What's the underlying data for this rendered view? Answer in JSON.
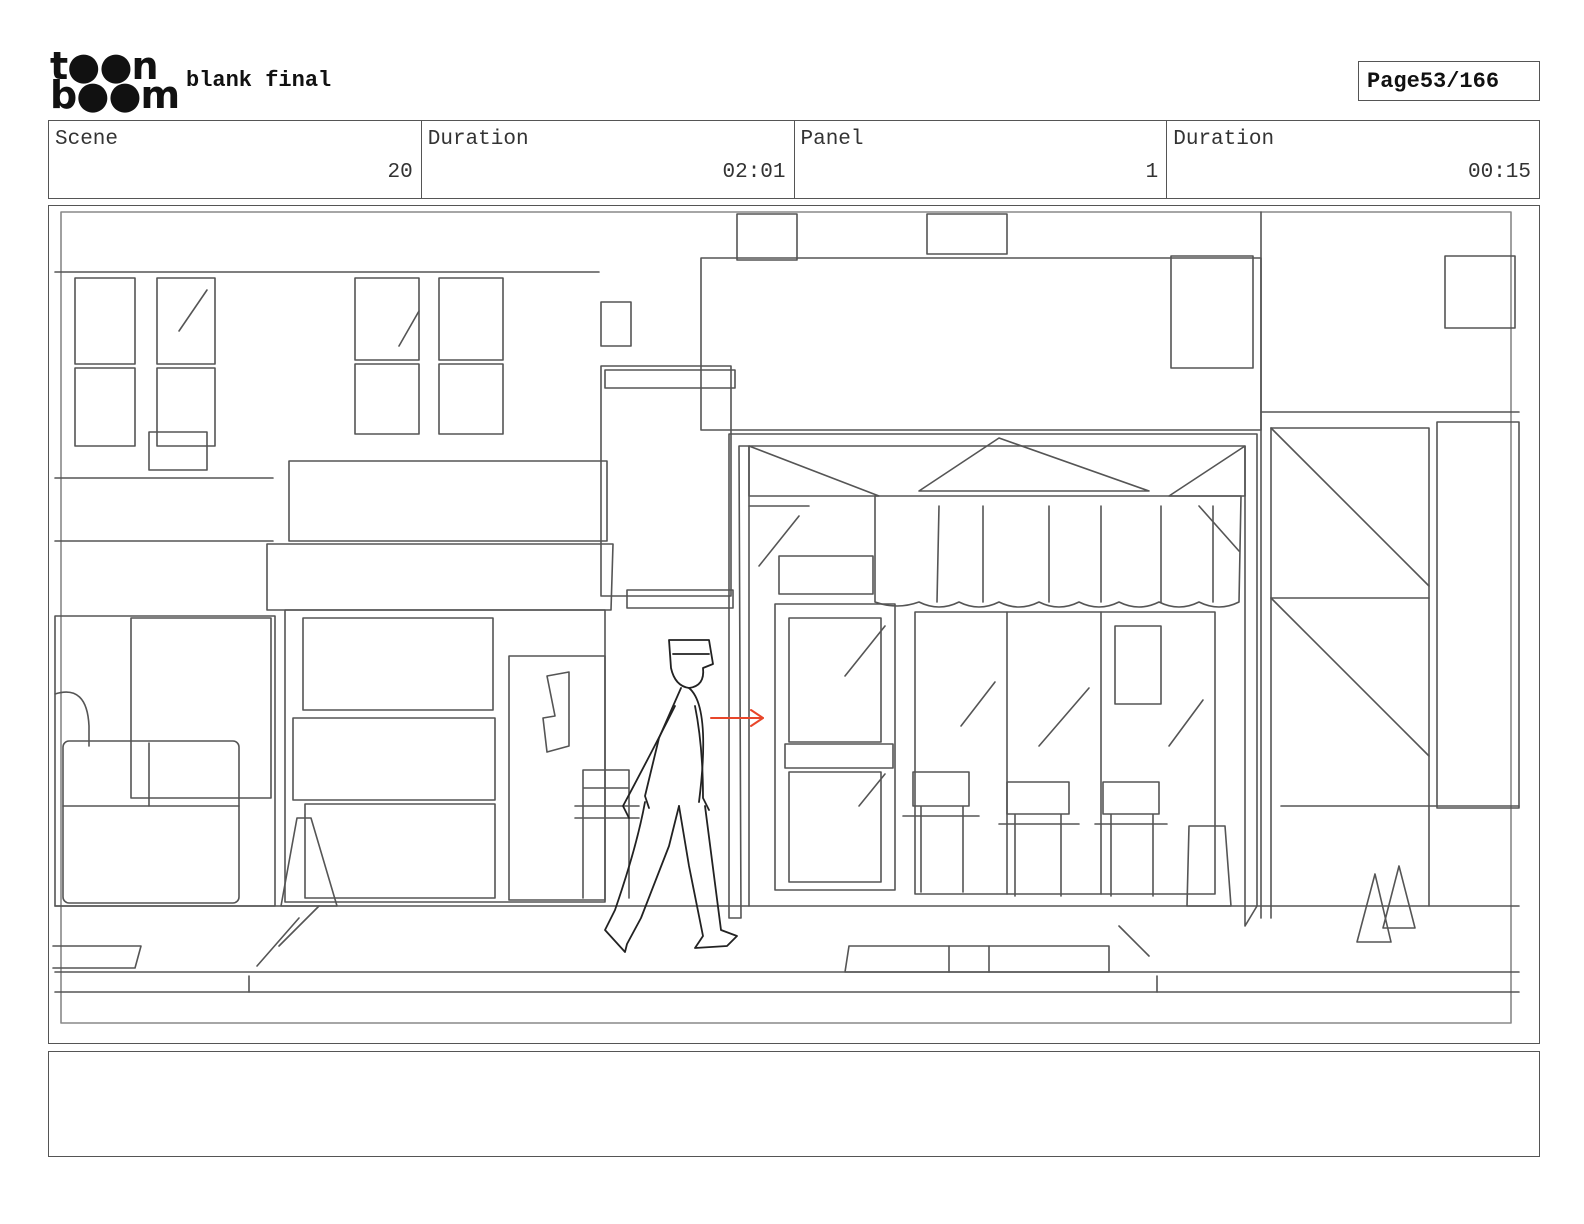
{
  "header": {
    "logo_line1": "t●●n",
    "logo_line2": "b●●m",
    "title": "blank final",
    "page_label": "Page",
    "page_value": "53/166"
  },
  "info": {
    "scene_label": "Scene",
    "scene_value": "20",
    "duration_label": "Duration",
    "duration_value": "02:01",
    "panel_label": "Panel",
    "panel_value": "1",
    "panel_duration_label": "Duration",
    "panel_duration_value": "00:15"
  },
  "colors": {
    "sketch_line": "#555555",
    "motion_arrow": "#e8462a"
  }
}
